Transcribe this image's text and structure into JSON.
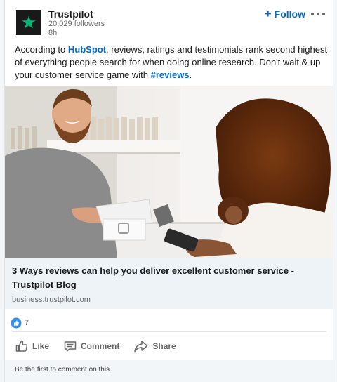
{
  "post": {
    "author": {
      "name": "Trustpilot",
      "followers": "20,029 followers",
      "time": "8h",
      "logo_icon": "trustpilot-star-icon",
      "logo_color": "#00b67a"
    },
    "follow_label": "Follow",
    "follow_icon": "plus-icon",
    "more_icon": "ellipsis-icon",
    "text": {
      "part1": "According to ",
      "link1": "HubSpot",
      "part2": ", reviews, ratings and testimonials rank second highest of everything people search for when doing online research. Don't wait & up your customer service game with ",
      "link2": "#reviews",
      "part3": "."
    },
    "article": {
      "image_icon": "store-checkout-photo",
      "title": "3 Ways reviews can help you deliver excellent customer service - Trustpilot Blog",
      "source": "business.trustpilot.com"
    },
    "reactions": {
      "icon": "like-reaction-icon",
      "count": "7"
    },
    "actions": [
      {
        "label": "Like",
        "icon": "thumbs-up-icon"
      },
      {
        "label": "Comment",
        "icon": "comment-icon"
      },
      {
        "label": "Share",
        "icon": "share-icon"
      }
    ],
    "comment_prompt": "Be the first to comment on this"
  },
  "colors": {
    "link": "#0a66c2",
    "logo_bg": "#191919",
    "article_bg": "#eef3f8"
  }
}
